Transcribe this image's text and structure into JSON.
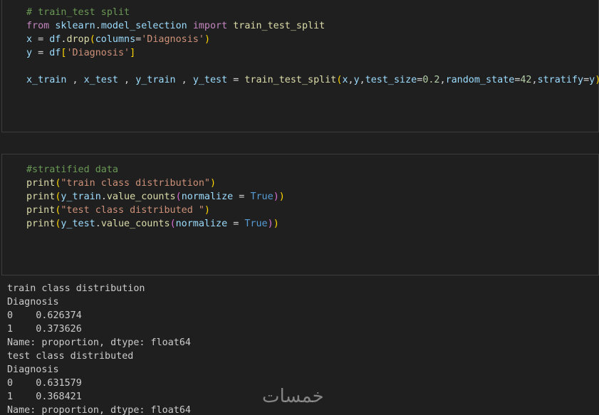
{
  "cell1": {
    "lines": [
      [
        {
          "t": "# train_test split",
          "c": "cmt"
        }
      ],
      [
        {
          "t": "from",
          "c": "kw"
        },
        {
          "t": " "
        },
        {
          "t": "sklearn",
          "c": "var"
        },
        {
          "t": ".",
          "c": "op"
        },
        {
          "t": "model_selection",
          "c": "var"
        },
        {
          "t": " "
        },
        {
          "t": "import",
          "c": "kw"
        },
        {
          "t": " "
        },
        {
          "t": "train_test_split",
          "c": "fn"
        }
      ],
      [
        {
          "t": "x",
          "c": "var"
        },
        {
          "t": " = ",
          "c": "op"
        },
        {
          "t": "df",
          "c": "var"
        },
        {
          "t": ".",
          "c": "op"
        },
        {
          "t": "drop",
          "c": "fn"
        },
        {
          "t": "(",
          "c": "p1"
        },
        {
          "t": "columns",
          "c": "var"
        },
        {
          "t": "=",
          "c": "op"
        },
        {
          "t": "'Diagnosis'",
          "c": "str"
        },
        {
          "t": ")",
          "c": "p1"
        }
      ],
      [
        {
          "t": "y",
          "c": "var"
        },
        {
          "t": " = ",
          "c": "op"
        },
        {
          "t": "df",
          "c": "var"
        },
        {
          "t": "[",
          "c": "p1"
        },
        {
          "t": "'Diagnosis'",
          "c": "str"
        },
        {
          "t": "]",
          "c": "p1"
        }
      ],
      [],
      [
        {
          "t": "x_train",
          "c": "var"
        },
        {
          "t": " , ",
          "c": "op"
        },
        {
          "t": "x_test",
          "c": "var"
        },
        {
          "t": " , ",
          "c": "op"
        },
        {
          "t": "y_train",
          "c": "var"
        },
        {
          "t": " , ",
          "c": "op"
        },
        {
          "t": "y_test",
          "c": "var"
        },
        {
          "t": " = ",
          "c": "op"
        },
        {
          "t": "train_test_split",
          "c": "fn"
        },
        {
          "t": "(",
          "c": "p1"
        },
        {
          "t": "x",
          "c": "var"
        },
        {
          "t": ",",
          "c": "op"
        },
        {
          "t": "y",
          "c": "var"
        },
        {
          "t": ",",
          "c": "op"
        },
        {
          "t": "test_size",
          "c": "var"
        },
        {
          "t": "=",
          "c": "op"
        },
        {
          "t": "0.2",
          "c": "num"
        },
        {
          "t": ",",
          "c": "op"
        },
        {
          "t": "random_state",
          "c": "var"
        },
        {
          "t": "=",
          "c": "op"
        },
        {
          "t": "42",
          "c": "num"
        },
        {
          "t": ",",
          "c": "op"
        },
        {
          "t": "stratify",
          "c": "var"
        },
        {
          "t": "=",
          "c": "op"
        },
        {
          "t": "y",
          "c": "var"
        },
        {
          "t": ")",
          "c": "p1"
        }
      ]
    ]
  },
  "cell2": {
    "lines": [
      [
        {
          "t": "#stratified data",
          "c": "cmt"
        }
      ],
      [
        {
          "t": "print",
          "c": "fn"
        },
        {
          "t": "(",
          "c": "p1"
        },
        {
          "t": "\"train class distribution\"",
          "c": "str"
        },
        {
          "t": ")",
          "c": "p1"
        }
      ],
      [
        {
          "t": "print",
          "c": "fn"
        },
        {
          "t": "(",
          "c": "p1"
        },
        {
          "t": "y_train",
          "c": "var"
        },
        {
          "t": ".",
          "c": "op"
        },
        {
          "t": "value_counts",
          "c": "fn"
        },
        {
          "t": "(",
          "c": "p2"
        },
        {
          "t": "normalize",
          "c": "var"
        },
        {
          "t": " = ",
          "c": "op"
        },
        {
          "t": "True",
          "c": "const"
        },
        {
          "t": ")",
          "c": "p2"
        },
        {
          "t": ")",
          "c": "p1"
        }
      ],
      [
        {
          "t": "print",
          "c": "fn"
        },
        {
          "t": "(",
          "c": "p1"
        },
        {
          "t": "\"test class distributed \"",
          "c": "str"
        },
        {
          "t": ")",
          "c": "p1"
        }
      ],
      [
        {
          "t": "print",
          "c": "fn"
        },
        {
          "t": "(",
          "c": "p1"
        },
        {
          "t": "y_test",
          "c": "var"
        },
        {
          "t": ".",
          "c": "op"
        },
        {
          "t": "value_counts",
          "c": "fn"
        },
        {
          "t": "(",
          "c": "p2"
        },
        {
          "t": "normalize",
          "c": "var"
        },
        {
          "t": " = ",
          "c": "op"
        },
        {
          "t": "True",
          "c": "const"
        },
        {
          "t": ")",
          "c": "p2"
        },
        {
          "t": ")",
          "c": "p1"
        }
      ]
    ]
  },
  "output": {
    "lines": [
      "train class distribution",
      "Diagnosis",
      "0    0.626374",
      "1    0.373626",
      "Name: proportion, dtype: float64",
      "test class distributed",
      "Diagnosis",
      "0    0.631579",
      "1    0.368421",
      "Name: proportion, dtype: float64"
    ]
  },
  "watermark": "خمسات"
}
